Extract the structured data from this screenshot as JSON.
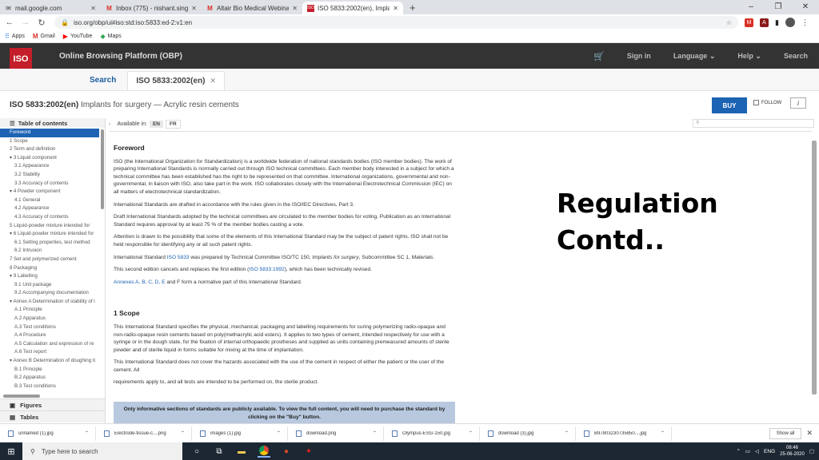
{
  "browser": {
    "tabs": [
      {
        "label": "mail.google.com",
        "icon": "mail-icon"
      },
      {
        "label": "Inbox (775) - nishant.singh.bme",
        "icon": "gmail-icon"
      },
      {
        "label": "Altair Bio Medical Webinar 25th",
        "icon": "gmail-icon"
      },
      {
        "label": "ISO 5833:2002(en), Implants for",
        "icon": "iso-icon"
      }
    ],
    "new_tab": "+",
    "url": "iso.org/obp/ui#iso:std:iso:5833:ed-2:v1:en",
    "bookmarks": [
      {
        "label": "Apps",
        "icon": "apps-icon"
      },
      {
        "label": "Gmail",
        "icon": "gmail-icon"
      },
      {
        "label": "YouTube",
        "icon": "youtube-icon"
      },
      {
        "label": "Maps",
        "icon": "maps-icon"
      }
    ]
  },
  "obp": {
    "logo": "ISO",
    "title": "Online Browsing Platform (OBP)",
    "nav": {
      "signin": "Sign in",
      "language": "Language",
      "help": "Help",
      "search": "Search"
    },
    "search_tab": "Search",
    "doc_tab": "ISO 5833:2002(en)"
  },
  "doc": {
    "code": "ISO 5833:2002(en)",
    "subtitle": "Implants for surgery — Acrylic resin cements",
    "buy": "BUY",
    "follow": "FOLLOW",
    "info": "i",
    "available_in": "Available in:",
    "lang_en": "EN",
    "lang_fr": "FR"
  },
  "toc": {
    "heading": "Table of contents",
    "items": [
      {
        "label": "Foreword",
        "level": 1,
        "active": true
      },
      {
        "label": "1 Scope",
        "level": 1
      },
      {
        "label": "2 Term and definition",
        "level": 1
      },
      {
        "label": "▾ 3 Liquid component",
        "level": 1
      },
      {
        "label": "3.1 Appearance",
        "level": 2
      },
      {
        "label": "3.2 Stability",
        "level": 2
      },
      {
        "label": "3.3 Accuracy of contents",
        "level": 2
      },
      {
        "label": "▾ 4 Powder component",
        "level": 1
      },
      {
        "label": "4.1 General",
        "level": 2
      },
      {
        "label": "4.2 Appearance",
        "level": 2
      },
      {
        "label": "4.3 Accuracy of contents",
        "level": 2
      },
      {
        "label": "5 Liquid-powder mixture intended for",
        "level": 1
      },
      {
        "label": "▾ 6 Liquid-powder mixture intended for",
        "level": 1
      },
      {
        "label": "6.1 Setting properties, test method",
        "level": 2
      },
      {
        "label": "6.2 Intrusion",
        "level": 2
      },
      {
        "label": "7 Set and polymerized cement",
        "level": 1
      },
      {
        "label": "8 Packaging",
        "level": 1
      },
      {
        "label": "▾ 9 Labelling",
        "level": 1
      },
      {
        "label": "9.1 Unit package",
        "level": 2
      },
      {
        "label": "9.2 Accompanying documentation",
        "level": 2
      },
      {
        "label": "▾ Annex A Determination of stability of l",
        "level": 1
      },
      {
        "label": "A.1 Principle",
        "level": 2
      },
      {
        "label": "A.2 Apparatus",
        "level": 2
      },
      {
        "label": "A.3 Test conditions",
        "level": 2
      },
      {
        "label": "A.4 Procedure",
        "level": 2
      },
      {
        "label": "A.5 Calculation and expression of re",
        "level": 2
      },
      {
        "label": "A.6 Test report",
        "level": 2
      },
      {
        "label": "▾ Annex B Determination of doughing ti",
        "level": 1
      },
      {
        "label": "B.1 Principle",
        "level": 2
      },
      {
        "label": "B.2 Apparatus",
        "level": 2
      },
      {
        "label": "B.3 Test conditions",
        "level": 2
      }
    ],
    "figures": "Figures",
    "tables": "Tables"
  },
  "content": {
    "foreword_title": "Foreword",
    "p1": "ISO (the International Organization for Standardization) is a worldwide federation of national standards bodies (ISO member bodies). The work of preparing International Standards is normally carried out through ISO technical committees. Each member body interested in a subject for which a technical committee has been established has the right to be represented on that committee. International organizations, governmental and non-governmental, in liaison with ISO, also take part in the work. ISO collaborates closely with the International Electrotechnical Commission (IEC) on all matters of electrotechnical standardization.",
    "p2": "International Standards are drafted in accordance with the rules given in the ISO/IEC Directives, Part 3.",
    "p3": "Draft International Standards adopted by the technical committees are circulated to the member bodies for voting. Publication as an International Standard requires approval by at least 75 % of the member bodies casting a vote.",
    "p4": "Attention is drawn to the possibility that some of the elements of this International Standard may be the subject of patent rights. ISO shall not be held responsible for identifying any or all such patent rights.",
    "p5_a": "International Standard ",
    "p5_link": "ISO 5833",
    "p5_b": " was prepared by Technical Committee ISO/TC 150, ",
    "p5_italic1": "Implants for surgery",
    "p5_c": ", Subcommittee SC 1, ",
    "p5_italic2": "Materials",
    "p5_d": ".",
    "p6_a": "This second edition cancels and replaces the first edition (",
    "p6_link": "ISO 5833:1992",
    "p6_b": "), which has been technically revised.",
    "p7_link": "Annexes A, B, C, D, E",
    "p7_b": " and F form a normative part of this International Standard.",
    "scope_title": "1   Scope",
    "s1": "This International Standard specifies the physical, mechanical, packaging and labelling requirements for curing polymerizing radio-opaque and non-radio-opaque resin cements based on poly(methacrylic acid esters). It applies to two types of cement, intended respectively for use with a syringe or in the dough state, for the fixation of internal orthopaedic prostheses and supplied as units containing premeasured amounts of sterile powder and of sterile liquid in forms suitable for mixing at the time of implantation.",
    "s2": "This International Standard does not cover the hazards associated with the use of the cement in respect of either the patient or the user of the cement. All",
    "s3": "requirements apply to, and all tests are intended to be performed on, the sterile product.",
    "notice": "Only informative sections of standards are publicly available. To view the full content, you will need to purchase the standard by clicking on the \"Buy\" button."
  },
  "overlay": {
    "line1": "Regulation",
    "line2": "Contd.."
  },
  "downloads": {
    "items": [
      "unnamed (1).jpg",
      "Electrode-tissue-c....png",
      "images (1).jpg",
      "download.png",
      "Olympus-ESG-150.jpg",
      "download (3).jpg",
      "B97803230735850....jpg"
    ],
    "show_all": "Show all"
  },
  "taskbar": {
    "search_placeholder": "Type here to search",
    "lang": "ENG",
    "time": "08:46",
    "date": "25-06-2020"
  }
}
